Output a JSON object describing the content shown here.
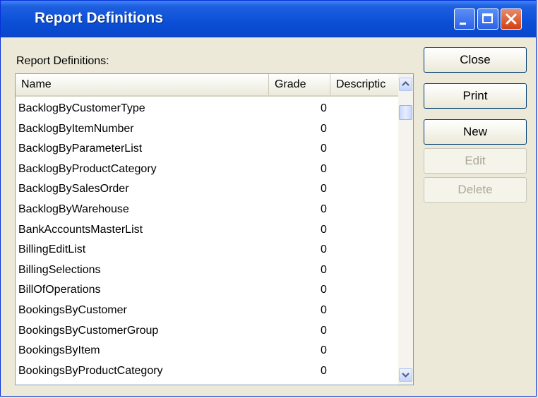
{
  "window": {
    "title": "Report Definitions"
  },
  "list_label": "Report Definitions:",
  "columns": [
    "Name",
    "Grade",
    "Descriptic"
  ],
  "rows": [
    {
      "name": "BacklogByCustomerType",
      "grade": "0"
    },
    {
      "name": "BacklogByItemNumber",
      "grade": "0"
    },
    {
      "name": "BacklogByParameterList",
      "grade": "0"
    },
    {
      "name": "BacklogByProductCategory",
      "grade": "0"
    },
    {
      "name": "BacklogBySalesOrder",
      "grade": "0"
    },
    {
      "name": "BacklogByWarehouse",
      "grade": "0"
    },
    {
      "name": "BankAccountsMasterList",
      "grade": "0"
    },
    {
      "name": "BillingEditList",
      "grade": "0"
    },
    {
      "name": "BillingSelections",
      "grade": "0"
    },
    {
      "name": "BillOfOperations",
      "grade": "0"
    },
    {
      "name": "BookingsByCustomer",
      "grade": "0"
    },
    {
      "name": "BookingsByCustomerGroup",
      "grade": "0"
    },
    {
      "name": "BookingsByItem",
      "grade": "0"
    },
    {
      "name": "BookingsByProductCategory",
      "grade": "0"
    }
  ],
  "buttons": {
    "close": "Close",
    "print": "Print",
    "new": "New",
    "edit": "Edit",
    "delete": "Delete"
  },
  "button_states": {
    "edit_enabled": false,
    "delete_enabled": false
  },
  "colors": {
    "titlebar": "#0a4fd6",
    "close_button": "#d23f12",
    "window_bg": "#ece9d8"
  }
}
